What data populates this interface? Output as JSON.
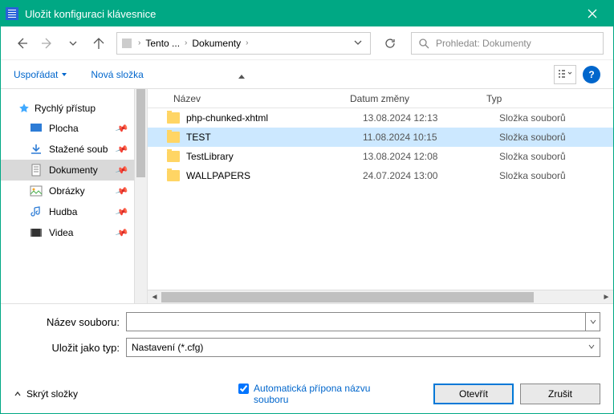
{
  "title": "Uložit konfiguraci klávesnice",
  "breadcrumb": {
    "root": "Tento ...",
    "current": "Dokumenty"
  },
  "search_placeholder": "Prohledat: Dokumenty",
  "toolbar": {
    "organize": "Uspořádat",
    "new_folder": "Nová složka"
  },
  "sidebar": {
    "quick_access": "Rychlý přístup",
    "items": [
      {
        "label": "Plocha",
        "active": false
      },
      {
        "label": "Stažené soub",
        "active": false
      },
      {
        "label": "Dokumenty",
        "active": true
      },
      {
        "label": "Obrázky",
        "active": false
      },
      {
        "label": "Hudba",
        "active": false
      },
      {
        "label": "Videa",
        "active": false
      }
    ]
  },
  "columns": {
    "name": "Název",
    "date": "Datum změny",
    "type": "Typ"
  },
  "rows": [
    {
      "name": "php-chunked-xhtml",
      "date": "13.08.2024 12:13",
      "type": "Složka souborů",
      "selected": false
    },
    {
      "name": "TEST",
      "date": "11.08.2024 10:15",
      "type": "Složka souborů",
      "selected": true
    },
    {
      "name": "TestLibrary",
      "date": "13.08.2024 12:08",
      "type": "Složka souborů",
      "selected": false
    },
    {
      "name": "WALLPAPERS",
      "date": "24.07.2024 13:00",
      "type": "Složka souborů",
      "selected": false
    }
  ],
  "form": {
    "filename_label": "Název souboru:",
    "filetype_label": "Uložit jako typ:",
    "filetype_value": "Nastavení (*.cfg)"
  },
  "footer": {
    "hide_folders": "Skrýt složky",
    "auto_ext": "Automatická přípona názvu souboru",
    "open": "Otevřít",
    "cancel": "Zrušit"
  },
  "help_char": "?"
}
